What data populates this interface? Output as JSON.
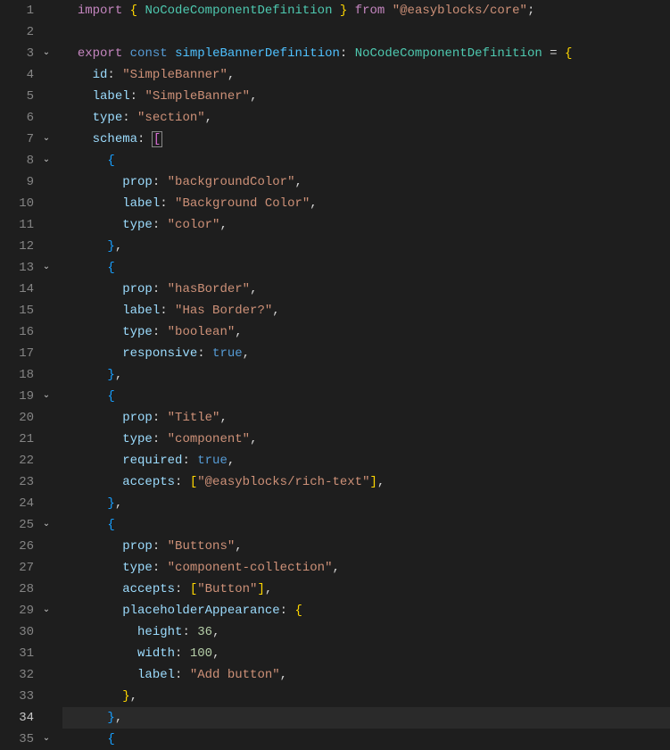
{
  "lines": [
    {
      "num": "1",
      "fold": "",
      "tokens": [
        {
          "t": "  ",
          "c": ""
        },
        {
          "t": "import",
          "c": "tk-keyword"
        },
        {
          "t": " ",
          "c": ""
        },
        {
          "t": "{",
          "c": "tk-brace"
        },
        {
          "t": " ",
          "c": ""
        },
        {
          "t": "NoCodeComponentDefinition",
          "c": "tk-type"
        },
        {
          "t": " ",
          "c": ""
        },
        {
          "t": "}",
          "c": "tk-brace"
        },
        {
          "t": " ",
          "c": ""
        },
        {
          "t": "from",
          "c": "tk-keyword"
        },
        {
          "t": " ",
          "c": ""
        },
        {
          "t": "\"@easyblocks/core\"",
          "c": "tk-string"
        },
        {
          "t": ";",
          "c": "tk-punct"
        }
      ]
    },
    {
      "num": "2",
      "fold": "",
      "tokens": [
        {
          "t": "",
          "c": ""
        }
      ]
    },
    {
      "num": "3",
      "fold": "v",
      "tokens": [
        {
          "t": "  ",
          "c": ""
        },
        {
          "t": "export",
          "c": "tk-keyword"
        },
        {
          "t": " ",
          "c": ""
        },
        {
          "t": "const",
          "c": "tk-const"
        },
        {
          "t": " ",
          "c": ""
        },
        {
          "t": "simpleBannerDefinition",
          "c": "tk-var"
        },
        {
          "t": ":",
          "c": "tk-punct"
        },
        {
          "t": " ",
          "c": ""
        },
        {
          "t": "NoCodeComponentDefinition",
          "c": "tk-type"
        },
        {
          "t": " ",
          "c": ""
        },
        {
          "t": "=",
          "c": "tk-punct"
        },
        {
          "t": " ",
          "c": ""
        },
        {
          "t": "{",
          "c": "tk-brace"
        }
      ]
    },
    {
      "num": "4",
      "fold": "",
      "tokens": [
        {
          "t": "    ",
          "c": ""
        },
        {
          "t": "id",
          "c": "tk-prop"
        },
        {
          "t": ":",
          "c": "tk-punct"
        },
        {
          "t": " ",
          "c": ""
        },
        {
          "t": "\"SimpleBanner\"",
          "c": "tk-string"
        },
        {
          "t": ",",
          "c": "tk-punct"
        }
      ]
    },
    {
      "num": "5",
      "fold": "",
      "tokens": [
        {
          "t": "    ",
          "c": ""
        },
        {
          "t": "label",
          "c": "tk-prop"
        },
        {
          "t": ":",
          "c": "tk-punct"
        },
        {
          "t": " ",
          "c": ""
        },
        {
          "t": "\"SimpleBanner\"",
          "c": "tk-string"
        },
        {
          "t": ",",
          "c": "tk-punct"
        }
      ]
    },
    {
      "num": "6",
      "fold": "",
      "tokens": [
        {
          "t": "    ",
          "c": ""
        },
        {
          "t": "type",
          "c": "tk-prop"
        },
        {
          "t": ":",
          "c": "tk-punct"
        },
        {
          "t": " ",
          "c": ""
        },
        {
          "t": "\"section\"",
          "c": "tk-string"
        },
        {
          "t": ",",
          "c": "tk-punct"
        }
      ]
    },
    {
      "num": "7",
      "fold": "v",
      "tokens": [
        {
          "t": "    ",
          "c": ""
        },
        {
          "t": "schema",
          "c": "tk-prop"
        },
        {
          "t": ":",
          "c": "tk-punct"
        },
        {
          "t": " ",
          "c": ""
        },
        {
          "t": "[",
          "c": "tk-brace2",
          "box": true
        }
      ]
    },
    {
      "num": "8",
      "fold": "v",
      "tokens": [
        {
          "t": "      ",
          "c": ""
        },
        {
          "t": "{",
          "c": "tk-brace3"
        }
      ]
    },
    {
      "num": "9",
      "fold": "",
      "tokens": [
        {
          "t": "        ",
          "c": ""
        },
        {
          "t": "prop",
          "c": "tk-prop"
        },
        {
          "t": ":",
          "c": "tk-punct"
        },
        {
          "t": " ",
          "c": ""
        },
        {
          "t": "\"backgroundColor\"",
          "c": "tk-string"
        },
        {
          "t": ",",
          "c": "tk-punct"
        }
      ]
    },
    {
      "num": "10",
      "fold": "",
      "tokens": [
        {
          "t": "        ",
          "c": ""
        },
        {
          "t": "label",
          "c": "tk-prop"
        },
        {
          "t": ":",
          "c": "tk-punct"
        },
        {
          "t": " ",
          "c": ""
        },
        {
          "t": "\"Background Color\"",
          "c": "tk-string"
        },
        {
          "t": ",",
          "c": "tk-punct"
        }
      ]
    },
    {
      "num": "11",
      "fold": "",
      "tokens": [
        {
          "t": "        ",
          "c": ""
        },
        {
          "t": "type",
          "c": "tk-prop"
        },
        {
          "t": ":",
          "c": "tk-punct"
        },
        {
          "t": " ",
          "c": ""
        },
        {
          "t": "\"color\"",
          "c": "tk-string"
        },
        {
          "t": ",",
          "c": "tk-punct"
        }
      ]
    },
    {
      "num": "12",
      "fold": "",
      "tokens": [
        {
          "t": "      ",
          "c": ""
        },
        {
          "t": "}",
          "c": "tk-brace3"
        },
        {
          "t": ",",
          "c": "tk-punct"
        }
      ]
    },
    {
      "num": "13",
      "fold": "v",
      "tokens": [
        {
          "t": "      ",
          "c": ""
        },
        {
          "t": "{",
          "c": "tk-brace3"
        }
      ]
    },
    {
      "num": "14",
      "fold": "",
      "tokens": [
        {
          "t": "        ",
          "c": ""
        },
        {
          "t": "prop",
          "c": "tk-prop"
        },
        {
          "t": ":",
          "c": "tk-punct"
        },
        {
          "t": " ",
          "c": ""
        },
        {
          "t": "\"hasBorder\"",
          "c": "tk-string"
        },
        {
          "t": ",",
          "c": "tk-punct"
        }
      ]
    },
    {
      "num": "15",
      "fold": "",
      "tokens": [
        {
          "t": "        ",
          "c": ""
        },
        {
          "t": "label",
          "c": "tk-prop"
        },
        {
          "t": ":",
          "c": "tk-punct"
        },
        {
          "t": " ",
          "c": ""
        },
        {
          "t": "\"Has Border?\"",
          "c": "tk-string"
        },
        {
          "t": ",",
          "c": "tk-punct"
        }
      ]
    },
    {
      "num": "16",
      "fold": "",
      "tokens": [
        {
          "t": "        ",
          "c": ""
        },
        {
          "t": "type",
          "c": "tk-prop"
        },
        {
          "t": ":",
          "c": "tk-punct"
        },
        {
          "t": " ",
          "c": ""
        },
        {
          "t": "\"boolean\"",
          "c": "tk-string"
        },
        {
          "t": ",",
          "c": "tk-punct"
        }
      ]
    },
    {
      "num": "17",
      "fold": "",
      "tokens": [
        {
          "t": "        ",
          "c": ""
        },
        {
          "t": "responsive",
          "c": "tk-prop"
        },
        {
          "t": ":",
          "c": "tk-punct"
        },
        {
          "t": " ",
          "c": ""
        },
        {
          "t": "true",
          "c": "tk-bool"
        },
        {
          "t": ",",
          "c": "tk-punct"
        }
      ]
    },
    {
      "num": "18",
      "fold": "",
      "tokens": [
        {
          "t": "      ",
          "c": ""
        },
        {
          "t": "}",
          "c": "tk-brace3"
        },
        {
          "t": ",",
          "c": "tk-punct"
        }
      ]
    },
    {
      "num": "19",
      "fold": "v",
      "tokens": [
        {
          "t": "      ",
          "c": ""
        },
        {
          "t": "{",
          "c": "tk-brace3"
        }
      ]
    },
    {
      "num": "20",
      "fold": "",
      "bp": true,
      "tokens": [
        {
          "t": "        ",
          "c": ""
        },
        {
          "t": "prop",
          "c": "tk-prop"
        },
        {
          "t": ":",
          "c": "tk-punct"
        },
        {
          "t": " ",
          "c": ""
        },
        {
          "t": "\"Title\"",
          "c": "tk-string"
        },
        {
          "t": ",",
          "c": "tk-punct"
        }
      ]
    },
    {
      "num": "21",
      "fold": "",
      "tokens": [
        {
          "t": "        ",
          "c": ""
        },
        {
          "t": "type",
          "c": "tk-prop"
        },
        {
          "t": ":",
          "c": "tk-punct"
        },
        {
          "t": " ",
          "c": ""
        },
        {
          "t": "\"component\"",
          "c": "tk-string"
        },
        {
          "t": ",",
          "c": "tk-punct"
        }
      ]
    },
    {
      "num": "22",
      "fold": "",
      "tokens": [
        {
          "t": "        ",
          "c": ""
        },
        {
          "t": "required",
          "c": "tk-prop"
        },
        {
          "t": ":",
          "c": "tk-punct"
        },
        {
          "t": " ",
          "c": ""
        },
        {
          "t": "true",
          "c": "tk-bool"
        },
        {
          "t": ",",
          "c": "tk-punct"
        }
      ]
    },
    {
      "num": "23",
      "fold": "",
      "tokens": [
        {
          "t": "        ",
          "c": ""
        },
        {
          "t": "accepts",
          "c": "tk-prop"
        },
        {
          "t": ":",
          "c": "tk-punct"
        },
        {
          "t": " ",
          "c": ""
        },
        {
          "t": "[",
          "c": "tk-brace4"
        },
        {
          "t": "\"@easyblocks/rich-text\"",
          "c": "tk-string"
        },
        {
          "t": "]",
          "c": "tk-brace4"
        },
        {
          "t": ",",
          "c": "tk-punct"
        }
      ]
    },
    {
      "num": "24",
      "fold": "",
      "tokens": [
        {
          "t": "      ",
          "c": ""
        },
        {
          "t": "}",
          "c": "tk-brace3"
        },
        {
          "t": ",",
          "c": "tk-punct"
        }
      ]
    },
    {
      "num": "25",
      "fold": "v",
      "tokens": [
        {
          "t": "      ",
          "c": ""
        },
        {
          "t": "{",
          "c": "tk-brace3"
        }
      ]
    },
    {
      "num": "26",
      "fold": "",
      "tokens": [
        {
          "t": "        ",
          "c": ""
        },
        {
          "t": "prop",
          "c": "tk-prop"
        },
        {
          "t": ":",
          "c": "tk-punct"
        },
        {
          "t": " ",
          "c": ""
        },
        {
          "t": "\"Buttons\"",
          "c": "tk-string"
        },
        {
          "t": ",",
          "c": "tk-punct"
        }
      ]
    },
    {
      "num": "27",
      "fold": "",
      "tokens": [
        {
          "t": "        ",
          "c": ""
        },
        {
          "t": "type",
          "c": "tk-prop"
        },
        {
          "t": ":",
          "c": "tk-punct"
        },
        {
          "t": " ",
          "c": ""
        },
        {
          "t": "\"component-collection\"",
          "c": "tk-string"
        },
        {
          "t": ",",
          "c": "tk-punct"
        }
      ]
    },
    {
      "num": "28",
      "fold": "",
      "tokens": [
        {
          "t": "        ",
          "c": ""
        },
        {
          "t": "accepts",
          "c": "tk-prop"
        },
        {
          "t": ":",
          "c": "tk-punct"
        },
        {
          "t": " ",
          "c": ""
        },
        {
          "t": "[",
          "c": "tk-brace4"
        },
        {
          "t": "\"Button\"",
          "c": "tk-string"
        },
        {
          "t": "]",
          "c": "tk-brace4"
        },
        {
          "t": ",",
          "c": "tk-punct"
        }
      ]
    },
    {
      "num": "29",
      "fold": "v",
      "tokens": [
        {
          "t": "        ",
          "c": ""
        },
        {
          "t": "placeholderAppearance",
          "c": "tk-prop"
        },
        {
          "t": ":",
          "c": "tk-punct"
        },
        {
          "t": " ",
          "c": ""
        },
        {
          "t": "{",
          "c": "tk-brace4"
        }
      ]
    },
    {
      "num": "30",
      "fold": "",
      "tokens": [
        {
          "t": "          ",
          "c": ""
        },
        {
          "t": "height",
          "c": "tk-prop"
        },
        {
          "t": ":",
          "c": "tk-punct"
        },
        {
          "t": " ",
          "c": ""
        },
        {
          "t": "36",
          "c": "tk-number"
        },
        {
          "t": ",",
          "c": "tk-punct"
        }
      ]
    },
    {
      "num": "31",
      "fold": "",
      "tokens": [
        {
          "t": "          ",
          "c": ""
        },
        {
          "t": "width",
          "c": "tk-prop"
        },
        {
          "t": ":",
          "c": "tk-punct"
        },
        {
          "t": " ",
          "c": ""
        },
        {
          "t": "100",
          "c": "tk-number"
        },
        {
          "t": ",",
          "c": "tk-punct"
        }
      ]
    },
    {
      "num": "32",
      "fold": "",
      "tokens": [
        {
          "t": "          ",
          "c": ""
        },
        {
          "t": "label",
          "c": "tk-prop"
        },
        {
          "t": ":",
          "c": "tk-punct"
        },
        {
          "t": " ",
          "c": ""
        },
        {
          "t": "\"Add button\"",
          "c": "tk-string"
        },
        {
          "t": ",",
          "c": "tk-punct"
        }
      ]
    },
    {
      "num": "33",
      "fold": "",
      "tokens": [
        {
          "t": "        ",
          "c": ""
        },
        {
          "t": "}",
          "c": "tk-brace4"
        },
        {
          "t": ",",
          "c": "tk-punct"
        }
      ]
    },
    {
      "num": "34",
      "fold": "",
      "active": true,
      "tokens": [
        {
          "t": "      ",
          "c": ""
        },
        {
          "t": "}",
          "c": "tk-brace3"
        },
        {
          "t": ",",
          "c": "tk-punct"
        }
      ]
    },
    {
      "num": "35",
      "fold": "v",
      "tokens": [
        {
          "t": "      ",
          "c": ""
        },
        {
          "t": "{",
          "c": "tk-brace3"
        }
      ]
    }
  ],
  "foldChevron": "⌄"
}
